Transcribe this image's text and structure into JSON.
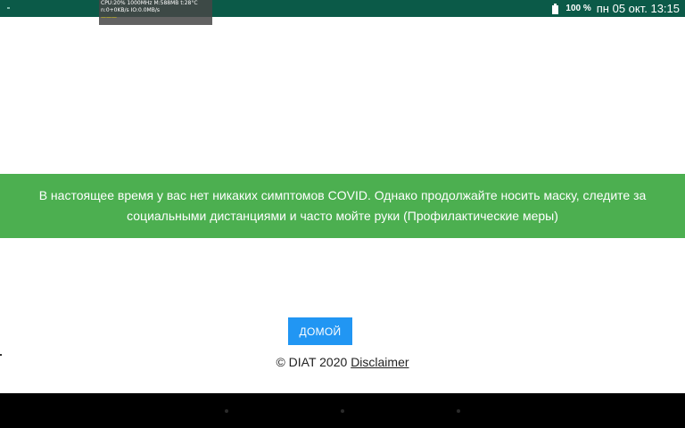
{
  "status_bar": {
    "battery_percent": "100 %",
    "datetime": "пн 05 окт. 13:15",
    "background_color": "#0b5a48"
  },
  "cpu_overlay": {
    "line1": "CPU:20% 1000MHz M:588MB t:28°C",
    "line2": "n:0+0KB/s IO:0.0MB/s",
    "line3": "———"
  },
  "banner": {
    "message": "В настоящее время у вас нет никаких симптомов COVID. Однако продолжайте носить маску, следите за социальными дистанциями и часто мойте руки (Профилактические меры)",
    "background_color": "#4caf50"
  },
  "home_button": {
    "label": "ДОМОЙ",
    "color": "#2196f3"
  },
  "footer": {
    "copyright": "© DIAT 2020",
    "disclaimer_link": "Disclaimer"
  }
}
